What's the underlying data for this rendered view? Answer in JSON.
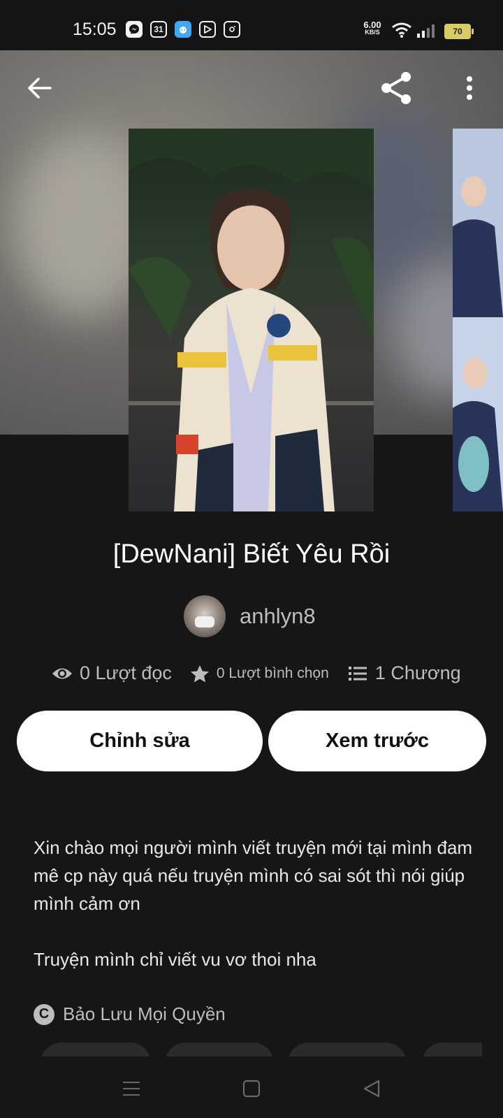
{
  "status_bar": {
    "time": "15:05",
    "app_icons": [
      "messenger-icon",
      "calendar-icon",
      "app-icon",
      "play-icon",
      "instagram-icon"
    ],
    "calendar_text": "31",
    "net_speed_value": "6.00",
    "net_speed_unit": "KB/S",
    "battery": "70"
  },
  "toolbar": {
    "back": "arrow-left-icon",
    "share": "share-icon",
    "more": "more-vertical-icon"
  },
  "story": {
    "title": "[DewNani] Biết Yêu Rồi",
    "author": "anhlyn8",
    "reads": "0 Lượt đọc",
    "votes": "0 Lượt bình chọn",
    "chapters": "1 Chương"
  },
  "actions": {
    "edit": "Chỉnh sửa",
    "preview": "Xem trước"
  },
  "description": {
    "paragraph1": "Xin chào mọi người mình viết truyện mới tại mình đam mê cp này quá nếu truyện mình có sai sót thì nói giúp mình cảm ơn",
    "paragraph2": "Truyện mình chỉ viết vu vơ thoi nha"
  },
  "copyright": {
    "icon_text": "C",
    "label": "Bảo Lưu Mọi Quyền"
  },
  "colors": {
    "background": "#161616",
    "button_bg": "#ffffff",
    "muted_text": "#bdbdbd",
    "battery": "#d8cc62"
  }
}
